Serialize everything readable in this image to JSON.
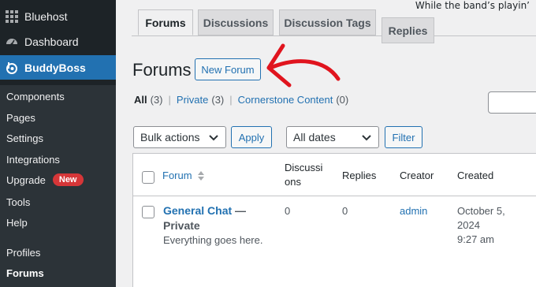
{
  "sidebar": {
    "top_items": [
      {
        "label": "Bluehost",
        "icon": "grid-icon"
      },
      {
        "label": "Dashboard",
        "icon": "dashboard-icon"
      },
      {
        "label": "BuddyBoss",
        "icon": "buddyboss-icon"
      }
    ],
    "sub_items": [
      {
        "label": "Components"
      },
      {
        "label": "Pages"
      },
      {
        "label": "Settings"
      },
      {
        "label": "Integrations"
      },
      {
        "label": "Upgrade",
        "badge": "New"
      },
      {
        "label": "Tools"
      },
      {
        "label": "Help"
      },
      {
        "label": "Profiles"
      },
      {
        "label": "Forums"
      }
    ]
  },
  "header": {
    "headline": "While the band’s playin’"
  },
  "tabs": [
    "Forums",
    "Discussions",
    "Discussion Tags",
    "Replies"
  ],
  "page_title": "Forums",
  "new_forum_label": "New Forum",
  "views": [
    {
      "label": "All",
      "count": "(3)"
    },
    {
      "label": "Private",
      "count": "(3)"
    },
    {
      "label": "Cornerstone Content",
      "count": "(0)"
    }
  ],
  "filters": {
    "bulk_actions": "Bulk actions",
    "apply": "Apply",
    "dates": "All dates",
    "filter": "Filter"
  },
  "table": {
    "columns": {
      "forum": "Forum",
      "discussions_line1": "Discussi",
      "discussions_line2": "ons",
      "replies": "Replies",
      "creator": "Creator",
      "created": "Created"
    },
    "rows": [
      {
        "title": "General Chat",
        "state": "— Private",
        "description": "Everything goes here.",
        "discussions": "0",
        "replies": "0",
        "creator": "admin",
        "created_line1": "October 5,",
        "created_line2": "2024",
        "created_line3": "9:27 am"
      }
    ]
  },
  "colors": {
    "accent": "#2271b1",
    "annotation": "#e0141e",
    "badge": "#d63638"
  }
}
